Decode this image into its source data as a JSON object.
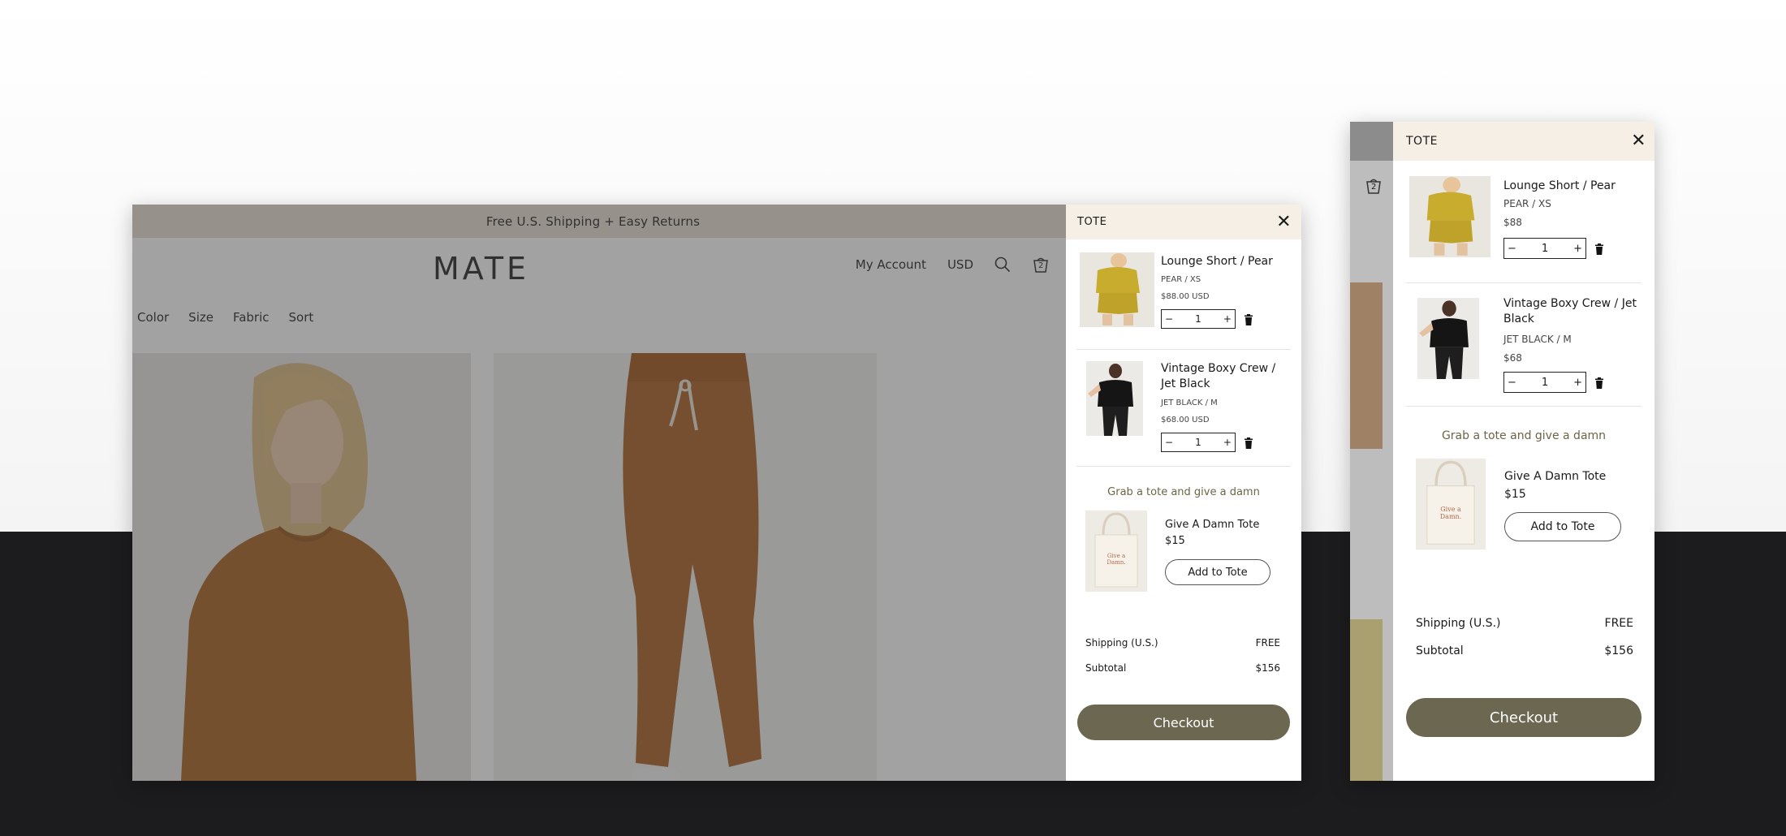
{
  "site": {
    "announcement": "Free U.S. Shipping + Easy Returns",
    "logo": "MATE",
    "header": {
      "my_account": "My Account",
      "currency": "USD",
      "cart_count": "2",
      "search_icon": "search-icon",
      "bag_icon": "bag-icon"
    },
    "filters": [
      "Color",
      "Size",
      "Fabric",
      "Sort"
    ]
  },
  "desktop_cart": {
    "title": "TOTE",
    "items": [
      {
        "name": "Lounge Short / Pear",
        "variant": "PEAR / XS",
        "price": "$88.00 USD",
        "qty": "1"
      },
      {
        "name": "Vintage Boxy Crew / Jet Black",
        "variant": "JET BLACK / M",
        "price": "$68.00 USD",
        "qty": "1"
      }
    ],
    "upsell": {
      "title": "Grab a tote and give a damn",
      "name": "Give A Damn Tote",
      "price": "$15",
      "button": "Add to Tote",
      "tote_print": "Give a Damn."
    },
    "shipping_label": "Shipping (U.S.)",
    "shipping_value": "FREE",
    "subtotal_label": "Subtotal",
    "subtotal_value": "$156",
    "checkout": "Checkout"
  },
  "mobile_cart": {
    "title": "TOTE",
    "cart_count": "2",
    "items": [
      {
        "name": "Lounge Short / Pear",
        "variant": "PEAR / XS",
        "price": "$88",
        "qty": "1"
      },
      {
        "name": "Vintage Boxy Crew / Jet Black",
        "variant": "JET BLACK / M",
        "price": "$68",
        "qty": "1"
      }
    ],
    "upsell": {
      "title": "Grab a tote and give a damn",
      "name": "Give A Damn Tote",
      "price": "$15",
      "button": "Add to Tote",
      "tote_print": "Give a Damn."
    },
    "shipping_label": "Shipping (U.S.)",
    "shipping_value": "FREE",
    "subtotal_label": "Subtotal",
    "subtotal_value": "$156",
    "checkout": "Checkout"
  },
  "colors": {
    "announcement_bg": "#e9ddd0",
    "drawer_header_bg": "#f6efe6",
    "checkout_bg": "#6b6750",
    "upsell_text": "#6b6545",
    "dark_bg": "#1c1c1e"
  }
}
